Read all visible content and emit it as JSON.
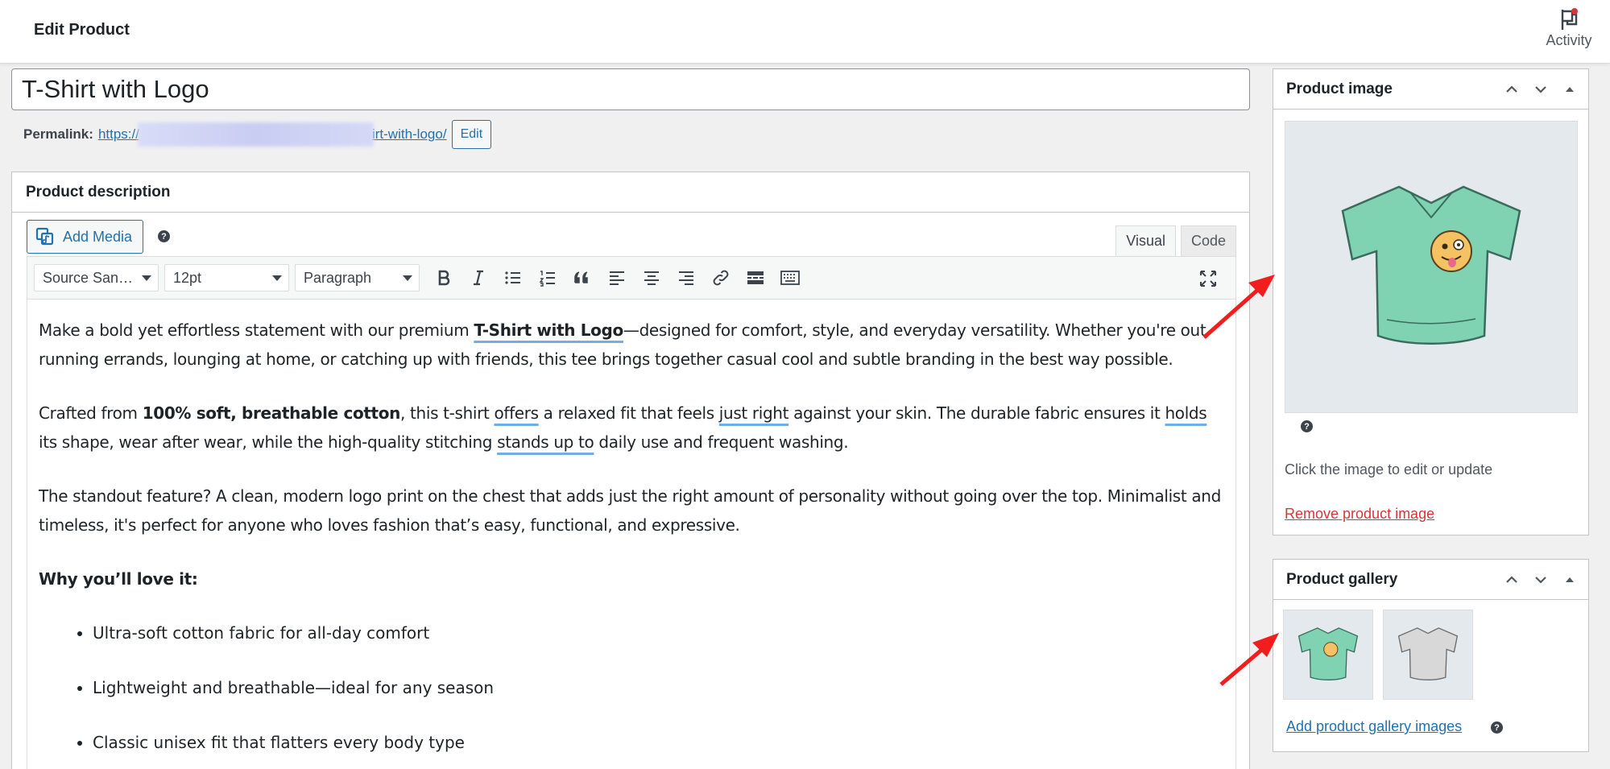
{
  "header": {
    "title": "Edit Product",
    "activity_label": "Activity"
  },
  "product": {
    "title": "T-Shirt with Logo",
    "permalink_label": "Permalink:",
    "permalink_start": "https://",
    "permalink_end": "irt-with-logo/",
    "permalink_edit": "Edit"
  },
  "description": {
    "heading": "Product description",
    "add_media": "Add Media",
    "help": "?",
    "tabs": [
      "Visual",
      "Code"
    ],
    "toolbar": {
      "font_family": "Source San…",
      "font_size": "12pt",
      "format": "Paragraph"
    },
    "p1": {
      "a": "Make a bold yet effortless statement with our premium ",
      "b": "T-Shirt with Logo",
      "c": "—designed for comfort, style, and everyday versatility. Whether you're out running errands, lounging at home, or catching up with friends, this tee brings together casual cool and subtle branding in the best way possible."
    },
    "p2": {
      "a": "Crafted from ",
      "b": "100% soft, breathable cotton",
      "c": ", this t-shirt ",
      "d": "offers",
      "e": " a relaxed fit that feels ",
      "f": "just right",
      "g": " against your skin. The durable fabric ensures it ",
      "h": "holds",
      "i": " its shape, wear after wear, while the high-quality stitching ",
      "j": "stands up to",
      "k": " daily use and frequent washing."
    },
    "p3": "The standout feature? A clean, modern logo print on the chest that adds just the right amount of personality without going over the top. Minimalist and timeless, it's perfect for anyone who loves fashion that’s easy, functional, and expressive.",
    "why_heading": "Why you’ll love it:",
    "bullets": [
      "Ultra-soft cotton fabric for all-day comfort",
      "Lightweight and breathable—ideal for any season",
      "Classic unisex fit that flatters every body type"
    ]
  },
  "product_image": {
    "heading": "Product image",
    "help": "?",
    "caption": "Click the image to edit or update",
    "remove": "Remove product image"
  },
  "product_gallery": {
    "heading": "Product gallery",
    "add": "Add product gallery images",
    "help": "?"
  },
  "colors": {
    "accent": "#2271b1",
    "danger": "#d63638",
    "arrow": "#f21d1d",
    "tshirt_green": "#7fd3b2",
    "tshirt_grey": "#d8d8d8"
  }
}
